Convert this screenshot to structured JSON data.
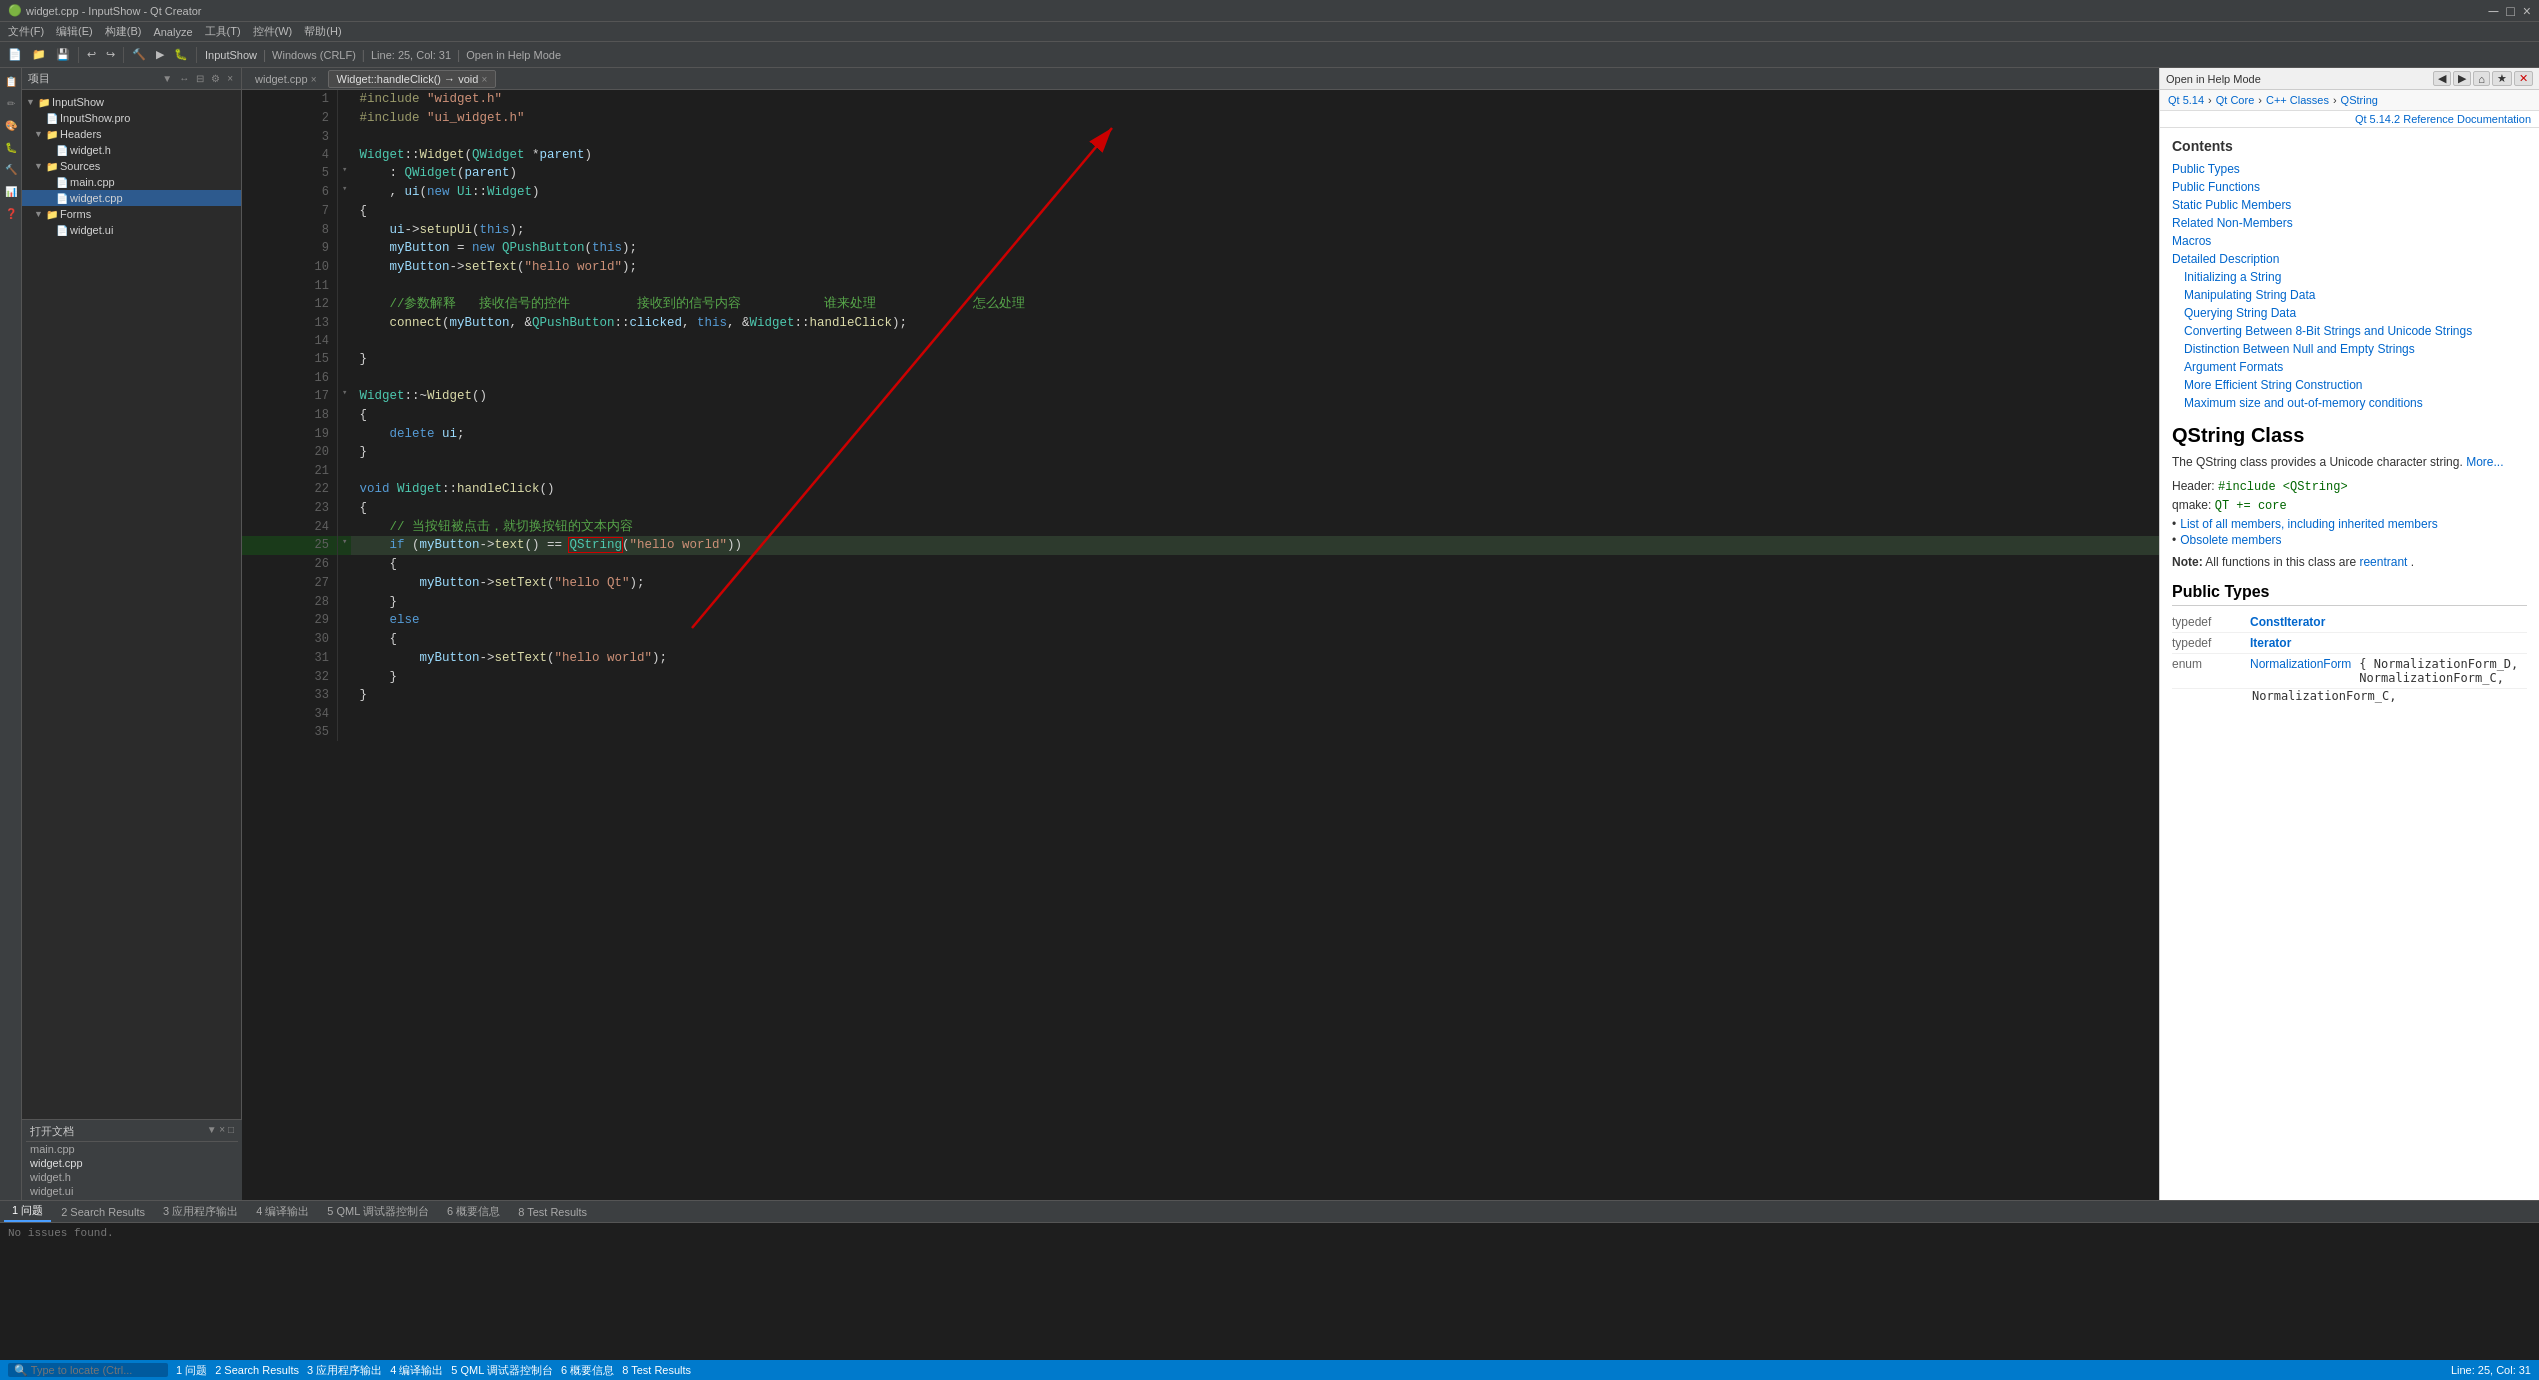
{
  "titlebar": {
    "title": "widget.cpp - InputShow - Qt Creator",
    "minimize": "─",
    "maximize": "□",
    "close": "×"
  },
  "menubar": {
    "items": [
      "文件(F)",
      "编辑(E)",
      "构建(B)",
      "Analyze",
      "工具(T)",
      "控件(W)",
      "帮助(H)"
    ]
  },
  "toolbar": {
    "project": "InputShow",
    "run_config": "Windows (CRLF)",
    "position": "Line: 25, Col: 31",
    "open_help": "Open in Help Mode"
  },
  "tabs": {
    "items": [
      {
        "label": "widget.cpp",
        "close": "×",
        "active": true
      },
      {
        "label": "Widget::handleClick() → void",
        "close": "×",
        "active": false
      }
    ]
  },
  "project_panel": {
    "header": "项目",
    "tree": [
      {
        "level": 0,
        "type": "project",
        "label": "InputShow",
        "arrow": "▼",
        "expanded": true
      },
      {
        "level": 1,
        "type": "project",
        "label": "InputShow.pro",
        "arrow": "",
        "expanded": false
      },
      {
        "level": 1,
        "type": "folder",
        "label": "Headers",
        "arrow": "▼",
        "expanded": true
      },
      {
        "level": 2,
        "type": "file_h",
        "label": "widget.h",
        "arrow": ""
      },
      {
        "level": 1,
        "type": "folder",
        "label": "Sources",
        "arrow": "▼",
        "expanded": true
      },
      {
        "level": 2,
        "type": "file_cpp",
        "label": "main.cpp",
        "arrow": ""
      },
      {
        "level": 2,
        "type": "file_cpp",
        "label": "widget.cpp",
        "arrow": "",
        "selected": true
      },
      {
        "level": 1,
        "type": "folder",
        "label": "Forms",
        "arrow": "▼",
        "expanded": true
      },
      {
        "level": 2,
        "type": "file_ui",
        "label": "widget.ui",
        "arrow": ""
      }
    ]
  },
  "open_files": {
    "header": "打开文档",
    "files": [
      "main.cpp",
      "widget.cpp",
      "widget.h",
      "widget.ui"
    ]
  },
  "code": {
    "lines": [
      {
        "num": 1,
        "text": "#include \"widget.h\"",
        "type": "include"
      },
      {
        "num": 2,
        "text": "#include \"ui_widget.h\"",
        "type": "include"
      },
      {
        "num": 3,
        "text": "",
        "type": "blank"
      },
      {
        "num": 4,
        "text": "Widget::Widget(QWidget *parent)",
        "type": "constructor"
      },
      {
        "num": 5,
        "text": "    : QWidget(parent)",
        "type": "init"
      },
      {
        "num": 6,
        "text": "    , ui(new Ui::Widget)",
        "type": "init",
        "fold": true
      },
      {
        "num": 7,
        "text": "{",
        "type": "brace"
      },
      {
        "num": 8,
        "text": "    ui->setupUi(this);",
        "type": "code"
      },
      {
        "num": 9,
        "text": "    myButton = new QPushButton(this);",
        "type": "code"
      },
      {
        "num": 10,
        "text": "    myButton->setText(\"hello world\");",
        "type": "code"
      },
      {
        "num": 11,
        "text": "",
        "type": "blank"
      },
      {
        "num": 12,
        "text": "    //参数解释   接收信号的控件         接收到的信号内容           谁来处理             怎么处理",
        "type": "comment"
      },
      {
        "num": 13,
        "text": "    connect(myButton, &QPushButton::clicked, this, &Widget::handleClick);",
        "type": "code"
      },
      {
        "num": 14,
        "text": "",
        "type": "blank"
      },
      {
        "num": 15,
        "text": "}",
        "type": "brace"
      },
      {
        "num": 16,
        "text": "",
        "type": "blank"
      },
      {
        "num": 17,
        "text": "Widget::~Widget()",
        "type": "destructor",
        "fold": true
      },
      {
        "num": 18,
        "text": "{",
        "type": "brace"
      },
      {
        "num": 19,
        "text": "    delete ui;",
        "type": "code"
      },
      {
        "num": 20,
        "text": "}",
        "type": "brace"
      },
      {
        "num": 21,
        "text": "",
        "type": "blank"
      },
      {
        "num": 22,
        "text": "void Widget::handleClick()",
        "type": "function"
      },
      {
        "num": 23,
        "text": "{",
        "type": "brace"
      },
      {
        "num": 24,
        "text": "    // 当按钮被点击，就切换按钮的文本内容",
        "type": "comment_cn"
      },
      {
        "num": 25,
        "text": "    if (myButton->text() == QString(\"hello world\"))",
        "type": "code_hl",
        "highlight": true
      },
      {
        "num": 26,
        "text": "    {",
        "type": "brace"
      },
      {
        "num": 27,
        "text": "        myButton->setText(\"hello Qt\");",
        "type": "code"
      },
      {
        "num": 28,
        "text": "    }",
        "type": "brace"
      },
      {
        "num": 29,
        "text": "    else",
        "type": "code"
      },
      {
        "num": 30,
        "text": "    {",
        "type": "brace"
      },
      {
        "num": 31,
        "text": "        myButton->setText(\"hello world\");",
        "type": "code"
      },
      {
        "num": 32,
        "text": "    }",
        "type": "brace"
      },
      {
        "num": 33,
        "text": "}",
        "type": "brace"
      },
      {
        "num": 34,
        "text": "",
        "type": "blank"
      },
      {
        "num": 35,
        "text": "",
        "type": "blank"
      }
    ]
  },
  "bottom_tabs": {
    "items": [
      "1 问题",
      "2 Search Results",
      "3 应用程序输出",
      "4 编译输出",
      "5 QML 调试器控制台",
      "6 概要信息",
      "8 Test Results"
    ]
  },
  "statusbar": {
    "items": [
      "1 问题",
      "2 Search Results",
      "3 应用程序输出",
      "4 编译输出",
      "5 QML 调试器控制台",
      "6 概要信息",
      "8 Test Results"
    ],
    "search_placeholder": "🔍 Type to locate (Ctrl...)"
  },
  "docs": {
    "toolbar": {
      "mode": "Open in Help Mode",
      "nav_back": "◀",
      "nav_fwd": "▶",
      "nav_home": "⌂",
      "nav_bookmark": "★",
      "nav_close": "✕"
    },
    "breadcrumb": {
      "items": [
        "Qt 5.14",
        "Qt Core",
        "C++ Classes",
        "QString"
      ]
    },
    "ref_link": "Qt 5.14.2 Reference Documentation",
    "contents": {
      "title": "Contents",
      "toc": [
        {
          "label": "Public Types",
          "sub": false
        },
        {
          "label": "Public Functions",
          "sub": false
        },
        {
          "label": "Static Public Members",
          "sub": false
        },
        {
          "label": "Related Non-Members",
          "sub": false
        },
        {
          "label": "Macros",
          "sub": false
        },
        {
          "label": "Detailed Description",
          "sub": false
        },
        {
          "label": "Initializing a String",
          "sub": true
        },
        {
          "label": "Manipulating String Data",
          "sub": true
        },
        {
          "label": "Querying String Data",
          "sub": true
        },
        {
          "label": "Converting Between 8-Bit Strings and Unicode Strings",
          "sub": true
        },
        {
          "label": "Distinction Between Null and Empty Strings",
          "sub": true
        },
        {
          "label": "Argument Formats",
          "sub": true
        },
        {
          "label": "More Efficient String Construction",
          "sub": true
        },
        {
          "label": "Maximum size and out-of-memory conditions",
          "sub": true
        }
      ]
    },
    "class_title": "QString Class",
    "class_desc": "The QString class provides a Unicode character string.",
    "more_label": "More...",
    "meta": {
      "header_label": "Header:",
      "header_value": "#include <QString>",
      "qmake_label": "qmake:",
      "qmake_value": "QT += core"
    },
    "links": [
      "List of all members, including inherited members",
      "Obsolete members"
    ],
    "note": "Note: All functions in this class are reentrant.",
    "public_types": {
      "title": "Public Types",
      "rows": [
        {
          "keyword": "typedef",
          "name": "ConstIterator"
        },
        {
          "keyword": "typedef",
          "name": "Iterator"
        },
        {
          "keyword": "enum",
          "name": "NormalizationForm",
          "values": "{ NormalizationForm_D, NormalizationForm_C, ..."
        }
      ]
    }
  }
}
